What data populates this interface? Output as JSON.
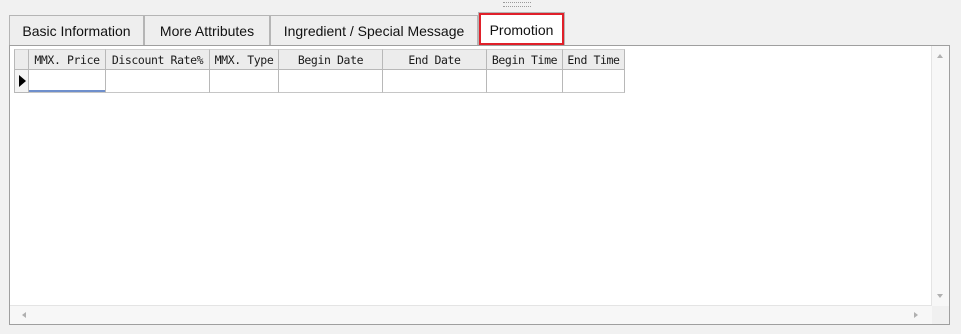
{
  "tabs": [
    {
      "label": "Basic Information"
    },
    {
      "label": "More Attributes"
    },
    {
      "label": "Ingredient / Special Message"
    },
    {
      "label": "Promotion"
    }
  ],
  "active_tab": "Promotion",
  "grid": {
    "columns": [
      "MMX. Price",
      "Discount Rate%",
      "MMX. Type",
      "Begin Date",
      "End Date",
      "Begin Time",
      "End Time"
    ],
    "rows": [
      [
        "",
        "",
        "",
        "",
        "",
        "",
        ""
      ]
    ]
  },
  "icons": {
    "row_indicator": "current-row-arrow-icon",
    "scroll_up": "scroll-up-icon",
    "scroll_down": "scroll-down-icon",
    "scroll_left": "scroll-left-icon",
    "scroll_right": "scroll-right-icon"
  },
  "colors": {
    "highlight": "#e0202a",
    "edit_underline": "#6f8fcc"
  }
}
